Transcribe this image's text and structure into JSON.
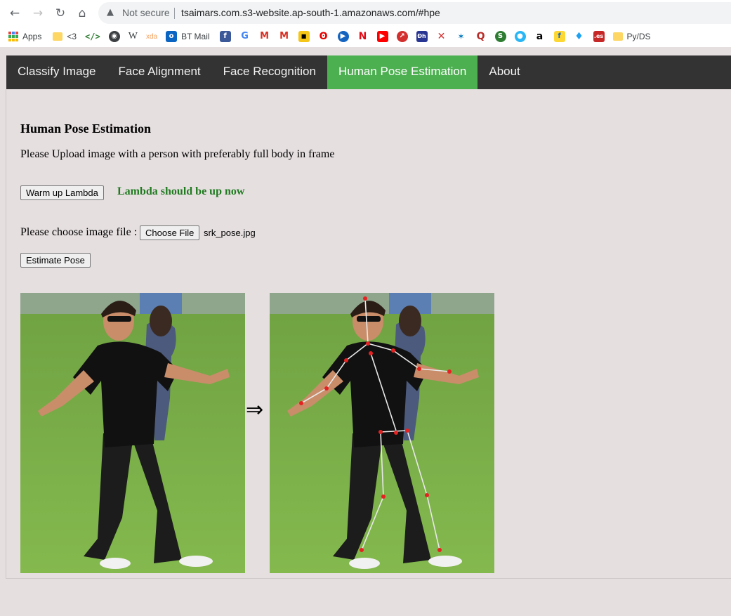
{
  "browser": {
    "security_icon": "warning-triangle-icon",
    "security_text": "Not secure",
    "url": "tsaimars.com.s3-website.ap-south-1.amazonaws.com/#hpe",
    "bookmarks": {
      "apps": "Apps",
      "heart": "<3",
      "code": "</>",
      "w": "W",
      "xda": "xda",
      "bt_mail": "BT Mail",
      "pyds": "Py/DS"
    }
  },
  "nav": {
    "items": [
      {
        "label": "Classify Image"
      },
      {
        "label": "Face Alignment"
      },
      {
        "label": "Face Recognition"
      },
      {
        "label": "Human Pose Estimation"
      },
      {
        "label": "About"
      }
    ],
    "active_color": "#4caf50",
    "bar_color": "#333333"
  },
  "page": {
    "title": "Human Pose Estimation",
    "description": "Please Upload image with a person with preferably full body in frame",
    "warmup_button": "Warm up Lambda",
    "lambda_status": "Lambda should be up now",
    "status_color": "#1f7a1f",
    "file_label": "Please choose image file :",
    "choose_file_button": "Choose File",
    "file_name": "srk_pose.jpg",
    "estimate_button": "Estimate Pose",
    "arrow": "⇒",
    "input_image_icon": "person-photo",
    "output_image_icon": "pose-skeleton-photo"
  }
}
